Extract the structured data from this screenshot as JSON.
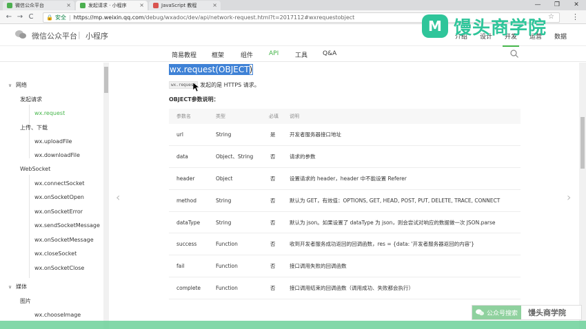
{
  "browser": {
    "tabs": [
      {
        "title": "微信公众平台",
        "fav_color": "#4caf50"
      },
      {
        "title": "发起请求 · 小程序",
        "fav_color": "#4caf50"
      },
      {
        "title": "JavaScript 教程",
        "fav_color": "#d9534f"
      }
    ],
    "window_controls": [
      "—",
      "❐",
      "✕"
    ],
    "nav": {
      "back": "←",
      "forward": "→",
      "reload": "C"
    },
    "security_label": "安全",
    "url_host": "https://mp.weixin.qq.com",
    "url_path": "/debug/wxadoc/dev/api/network-request.html?t=2017112#wxrequestobject"
  },
  "site": {
    "brand": "微信公众平台",
    "brand_sep": "|",
    "brand_sub": "小程序",
    "top_nav": [
      "介绍",
      "设计",
      "开发",
      "运营",
      "数据"
    ],
    "watermark_text": "馒头商学院",
    "watermark_badge": "M"
  },
  "subnav": {
    "items": [
      "简易教程",
      "框架",
      "组件",
      "API",
      "工具",
      "Q&A"
    ],
    "active": "API"
  },
  "sidebar": {
    "items": [
      {
        "label": "网络",
        "level": 0,
        "caret": "∨"
      },
      {
        "label": "发起请求",
        "level": 1
      },
      {
        "label": "wx.request",
        "level": 2,
        "active": true
      },
      {
        "label": "上传、下载",
        "level": 1
      },
      {
        "label": "wx.uploadFile",
        "level": 2
      },
      {
        "label": "wx.downloadFile",
        "level": 2
      },
      {
        "label": "WebSocket",
        "level": 1
      },
      {
        "label": "wx.connectSocket",
        "level": 2
      },
      {
        "label": "wx.onSocketOpen",
        "level": 2
      },
      {
        "label": "wx.onSocketError",
        "level": 2
      },
      {
        "label": "wx.sendSocketMessage",
        "level": 2
      },
      {
        "label": "wx.onSocketMessage",
        "level": 2
      },
      {
        "label": "wx.closeSocket",
        "level": 2
      },
      {
        "label": "wx.onSocketClose",
        "level": 2
      },
      {
        "label": "媒体",
        "level": 0,
        "caret": "∨"
      },
      {
        "label": "图片",
        "level": 1
      },
      {
        "label": "wx.chooseImage",
        "level": 2
      }
    ]
  },
  "main": {
    "heading_selected": "wx.request(OBJECT",
    "heading_tail": ")",
    "desc_code": "wx.request",
    "desc_text": "发起的是 HTTPS 请求。",
    "obj_title": "OBJECT参数说明：",
    "columns": [
      "参数名",
      "类型",
      "必填",
      "说明"
    ],
    "rows": [
      [
        "url",
        "String",
        "是",
        "开发者服务器接口地址"
      ],
      [
        "data",
        "Object、String",
        "否",
        "请求的参数"
      ],
      [
        "header",
        "Object",
        "否",
        "设置请求的 header，header 中不能设置 Referer"
      ],
      [
        "method",
        "String",
        "否",
        "默认为 GET，有效值：OPTIONS, GET, HEAD, POST, PUT, DELETE, TRACE, CONNECT"
      ],
      [
        "dataType",
        "String",
        "否",
        "默认为 json。如果设置了 dataType 为 json，则会尝试对响应的数据做一次 JSON.parse"
      ],
      [
        "success",
        "Function",
        "否",
        "收到开发者服务成功返回的回调函数，res = {data: '开发者服务器返回的内容'}"
      ],
      [
        "fail",
        "Function",
        "否",
        "接口调用失败的回调函数"
      ],
      [
        "complete",
        "Function",
        "否",
        "接口调用结束的回调函数（调用成功、失败都会执行）"
      ]
    ],
    "prev_arrow": "‹",
    "next_arrow": "›"
  },
  "overlay": {
    "qr_left": "公众号搜索",
    "qr_right": "馒头商学院"
  },
  "colors": {
    "accent_green": "#44b549",
    "selection_blue": "#3f82d6",
    "watermark": "#2fc59a"
  }
}
